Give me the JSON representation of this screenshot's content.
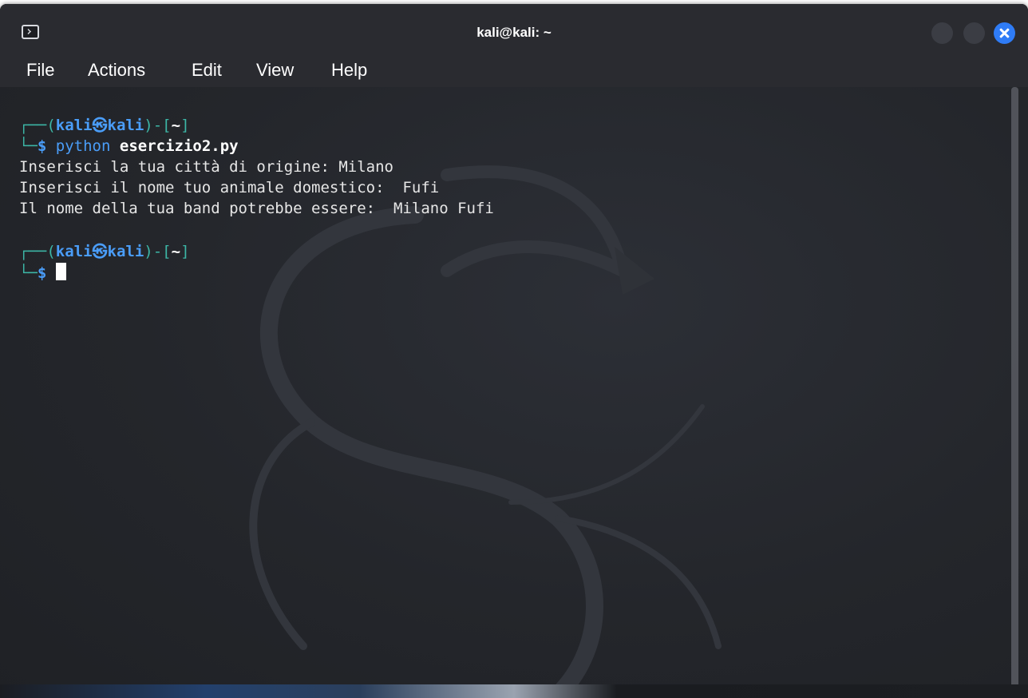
{
  "window": {
    "title": "kali@kali: ~",
    "icon": "terminal-icon",
    "controls": [
      "minimize-button",
      "maximize-button",
      "close-button"
    ]
  },
  "menu": {
    "file": "File",
    "actions": "Actions",
    "edit": "Edit",
    "view": "View",
    "help": "Help"
  },
  "terminal": {
    "prompt1": {
      "corner": "┌──",
      "open": "(",
      "user_host": "kali㉿kali",
      "close": ")-[",
      "dir": "~",
      "end": "]",
      "arrow": "└─",
      "dollar": "$",
      "cmd": "python",
      "arg": "esercizio2.py"
    },
    "output": [
      "Inserisci la tua città di origine: Milano",
      "Inserisci il nome tuo animale domestico:  Fufi",
      "Il nome della tua band potrebbe essere:  Milano Fufi"
    ],
    "prompt2": {
      "corner": "┌──",
      "open": "(",
      "user_host": "kali㉿kali",
      "close": ")-[",
      "dir": "~",
      "end": "]",
      "arrow": "└─",
      "dollar": "$"
    }
  },
  "colors": {
    "prompt_frame": "#3cb6a6",
    "prompt_user": "#4a9df8",
    "close_button": "#2f7cf6",
    "background": "#2b2d32"
  }
}
